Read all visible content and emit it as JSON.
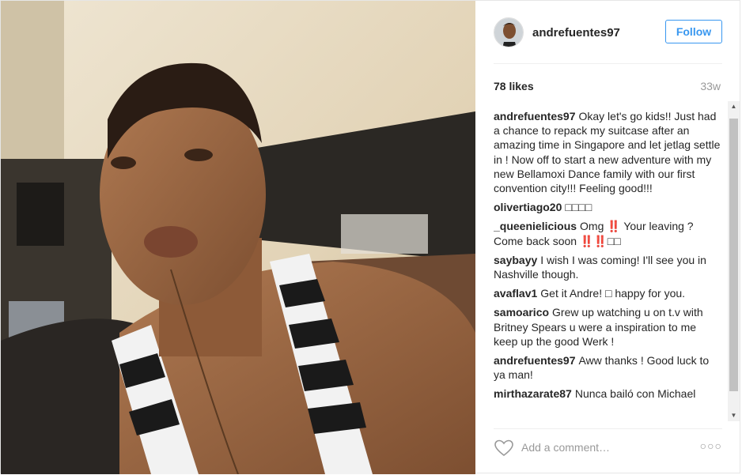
{
  "post": {
    "username": "andrefuentes97",
    "follow_label": "Follow",
    "likes": "78 likes",
    "age": "33w",
    "comments": [
      {
        "user": "andrefuentes97",
        "text": "Okay let's go kids!! Just had a chance to repack my suitcase after an amazing time in Singapore and let jetlag settle in ! Now off to start a new adventure with my new Bellamoxi Dance family with our first convention city!!! Feeling good!!!"
      },
      {
        "user": "olivertiago20",
        "text": "□□□□"
      },
      {
        "user": "_queenielicious",
        "text": "Omg ‼️ Your leaving ? Come back soon ‼️‼️□□"
      },
      {
        "user": "saybayy",
        "text": "I wish I was coming! I'll see you in Nashville though."
      },
      {
        "user": "avaflav1",
        "text": "Get it Andre! □ happy for you."
      },
      {
        "user": "samoarico",
        "text": "Grew up watching u on t.v with Britney Spears u were a inspiration to me keep up the good Werk !"
      },
      {
        "user": "andrefuentes97",
        "text": "Aww thanks ! Good luck to ya man!"
      },
      {
        "user": "mirthazarate87",
        "text": "Nunca bailó con Michael"
      }
    ],
    "add_comment_placeholder": "Add a comment…",
    "more_label": "○○○"
  },
  "icons": {
    "heart": "heart-icon",
    "more": "more-options-icon",
    "scroll_up": "scroll-up-arrow-icon",
    "scroll_down": "scroll-down-arrow-icon"
  },
  "colors": {
    "accent": "#3897f0",
    "muted": "#999999",
    "border": "#efefef"
  }
}
